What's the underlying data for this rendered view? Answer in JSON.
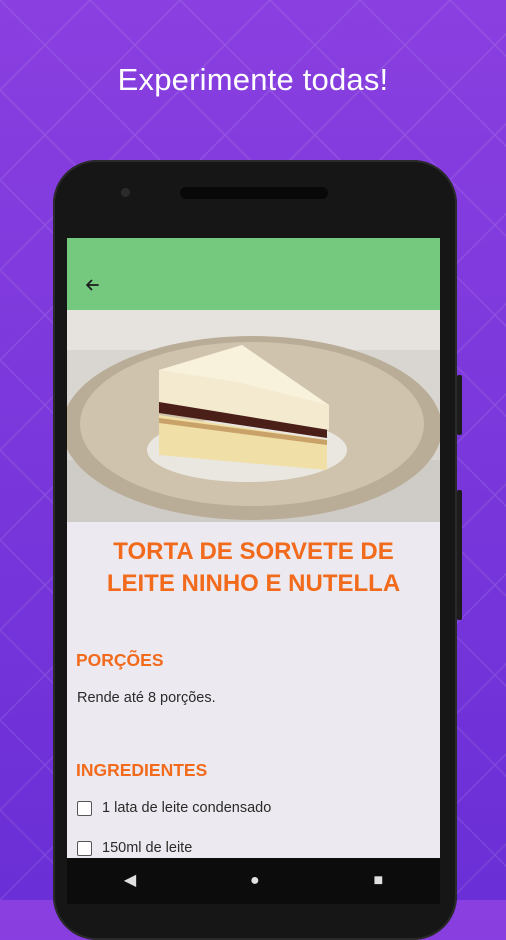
{
  "headline": "Experimente todas!",
  "appbar": {
    "back_icon": "arrow-left-icon"
  },
  "recipe": {
    "title_line1": "TORTA DE SORVETE DE",
    "title_line2": "LEITE NINHO E NUTELLA",
    "portions_heading": "PORÇÕES",
    "portions_text": "Rende até 8 porções.",
    "ingredients_heading": "INGREDIENTES",
    "ingredients": [
      "1 lata de leite condensado",
      "150ml de leite"
    ]
  },
  "navbar": {
    "back": "◀",
    "home": "●",
    "recents": "■"
  },
  "colors": {
    "appbar": "#74c97e",
    "accent": "#f26a1b",
    "background": "#7b36dc"
  }
}
